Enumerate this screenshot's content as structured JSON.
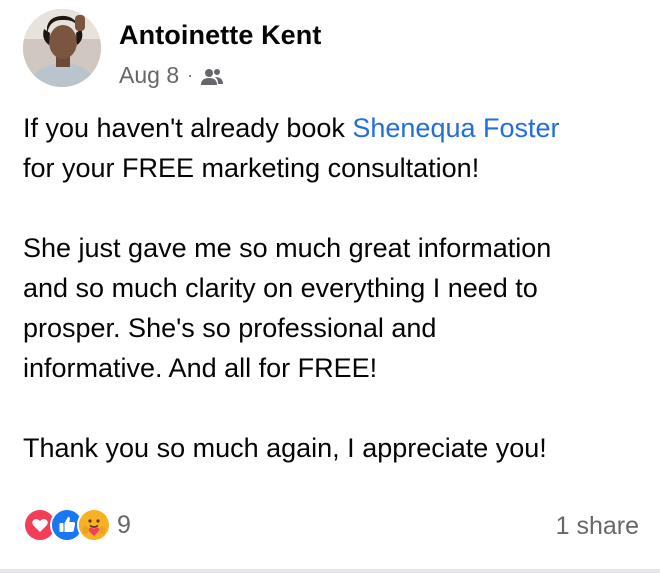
{
  "post": {
    "author": "Antoinette Kent",
    "date": "Aug 8",
    "separator": "·",
    "audience_icon": "friends-icon",
    "text_line1_before_mention": "If you haven't already book ",
    "mention": "Shenequa Foster",
    "text_line2": "for your FREE marketing consultation!",
    "paragraph2_line1": "She just gave me so much great information",
    "paragraph2_line2": "and so much clarity on everything I need to",
    "paragraph2_line3": "prosper. She's so professional and",
    "paragraph2_line4": "informative. And all for FREE!",
    "paragraph3": "Thank you so much again, I appreciate you!"
  },
  "footer": {
    "reaction_icons": [
      "love-reaction-icon",
      "like-reaction-icon",
      "care-reaction-icon"
    ],
    "reaction_count": "9",
    "shares": "1 share"
  },
  "colors": {
    "mention": "#216fdb",
    "secondary_text": "#65676b",
    "love": "#f33e58",
    "like": "#1877f2",
    "care": "#f7b125"
  }
}
